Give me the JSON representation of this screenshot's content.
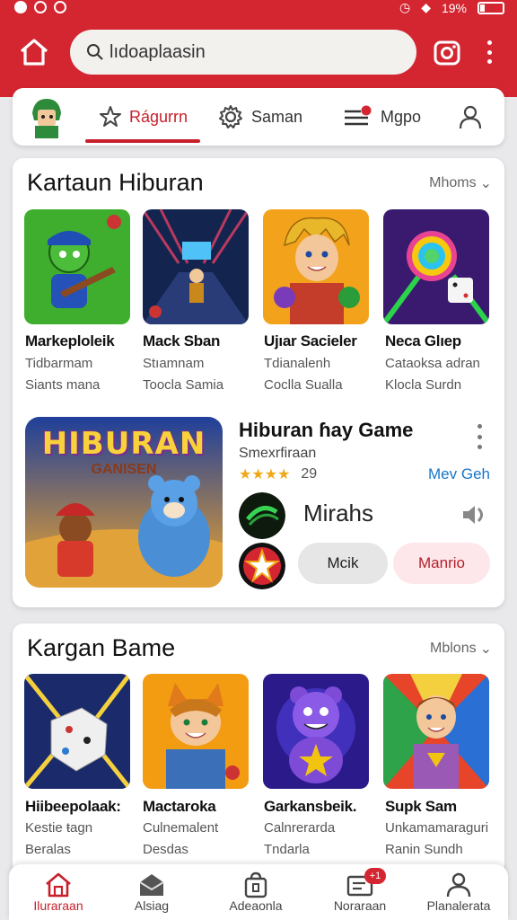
{
  "status_bar": {
    "battery": "19%"
  },
  "header": {
    "search": {
      "value": "lıdoaplaasin"
    }
  },
  "tabs": [
    {
      "label": "Rágurrn",
      "icon": "star-icon",
      "active": true
    },
    {
      "label": "Saman",
      "icon": "gear-icon",
      "active": false
    },
    {
      "label": "Mgpo",
      "icon": "list-icon",
      "active": false
    }
  ],
  "section1": {
    "title": "Kartaun Hiburan",
    "see_more": "Mhoms",
    "games": [
      {
        "title": "Markeploleik",
        "line1": "Tidbarmam",
        "line2": "Siants mana"
      },
      {
        "title": "Mack Sban",
        "line1": "Stıamnam",
        "line2": "Toocla Samia"
      },
      {
        "title": "Ujıar Sacieler",
        "line1": "Tdianalenh",
        "line2": "Coclla Sualla"
      },
      {
        "title": "Neca Glıep",
        "line1": "Cataoksa adran",
        "line2": "Klocla Surdn"
      }
    ],
    "featured": {
      "banner_title": "HIBURAN",
      "banner_sub": "GANISEN",
      "title": "Hiburan ɦay Game",
      "subtitle": "Smexrfiraan",
      "rating_count": "29",
      "link": "Mev Geh",
      "mini_name": "Mirahs",
      "button_grey": "Mcik",
      "button_pink": "Manrio"
    }
  },
  "section2": {
    "title": "Kargan Bame",
    "see_more": "Mblons",
    "games": [
      {
        "title": "Hiibeepolaak:",
        "line1": "Kestie ŧagn",
        "line2": "Beralas"
      },
      {
        "title": "Mactaroka",
        "line1": "Culnemalent",
        "line2": "Desdas"
      },
      {
        "title": "Garkansbeik.",
        "line1": "Calnrerarda",
        "line2": "Tndarla"
      },
      {
        "title": "Supk Sam",
        "line1": "Unkamamaraguri",
        "line2": "Ranin Sundh"
      }
    ]
  },
  "bottom_nav": [
    {
      "label": "Iluraraan",
      "icon": "home-icon",
      "active": true
    },
    {
      "label": "Alsiag",
      "icon": "mail-icon",
      "active": false
    },
    {
      "label": "Adeaonla",
      "icon": "bag-icon",
      "active": false
    },
    {
      "label": "Noraraan",
      "icon": "inbox-icon",
      "active": false,
      "badge": "+1"
    },
    {
      "label": "Planalerata",
      "icon": "profile-icon",
      "active": false
    }
  ],
  "colors": {
    "brand_red": "#d32631",
    "link_blue": "#1976c7"
  }
}
